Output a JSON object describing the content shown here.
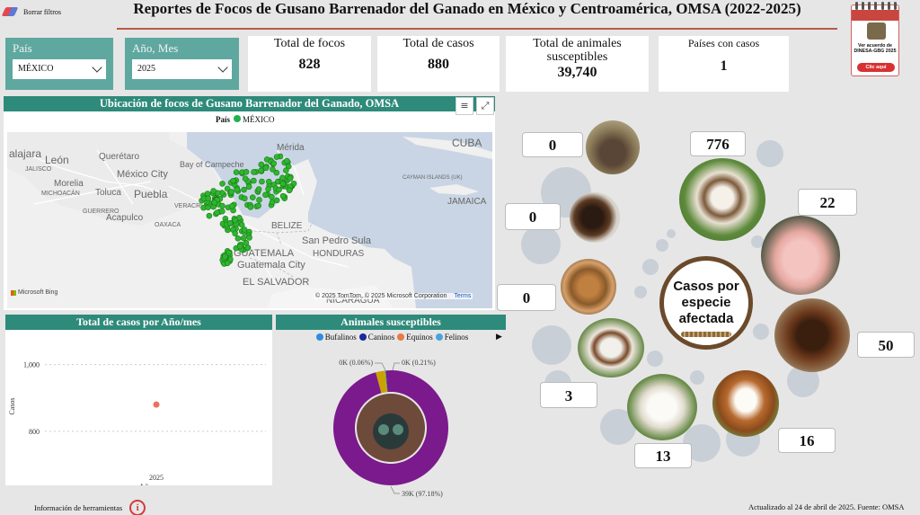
{
  "header": {
    "clear_filters_label": "Borrar filtros",
    "title": "Reportes de Focos de Gusano Barrenador del Ganado en México y Centroamérica, OMSA (2022-2025)"
  },
  "calendar_badge": {
    "text": "Ver acuerdo de DINESA-GBG 2025",
    "button_label": "Clic aquí"
  },
  "filters": {
    "country": {
      "label": "País",
      "value": "MÉXICO"
    },
    "year_month": {
      "label": "Año, Mes",
      "value": "2025"
    }
  },
  "kpis": [
    {
      "label": "Total de focos",
      "value": "828"
    },
    {
      "label": "Total de casos",
      "value": "880"
    },
    {
      "label": "Total de animales susceptibles",
      "value": "39,740"
    },
    {
      "label": "Países con casos",
      "value": "1"
    }
  ],
  "map": {
    "title": "Ubicación de focos de Gusano Barrenador del Ganado, OMSA",
    "legend_title": "País",
    "legend_item": "MÉXICO",
    "legend_color": "#22b14c",
    "labels": [
      "alajara",
      "León",
      "Querétaro",
      "JALISCO",
      "México City",
      "Morelia",
      "MICHOACÁN",
      "Toluca",
      "Puebla",
      "GUERRERO",
      "Acapulco",
      "OAXACA",
      "VERACRUZ",
      "Bay of Campeche",
      "Mérida",
      "BELIZE",
      "GUATEMALA",
      "Guatemala City",
      "San Pedro Sula",
      "HONDURAS",
      "EL SALVADOR",
      "NICARAGUA",
      "CUBA",
      "CAYMAN ISLANDS (UK)",
      "JAMAICA"
    ],
    "attribution": "© 2025 TomTom, © 2025 Microsoft Corporation",
    "terms_link": "Terms",
    "logo_text": "Microsoft Bing",
    "filter_icon": "filter-icon",
    "expand_icon": "focus-mode-icon"
  },
  "chart_data": [
    {
      "type": "scatter",
      "title": "Total de casos por Año/mes",
      "xlabel": "Año y mes",
      "ylabel": "Casos",
      "x": [
        "2025"
      ],
      "y": [
        880
      ],
      "yticks": [
        "1,000",
        "800"
      ],
      "ylim": [
        700,
        1050
      ],
      "grid": true,
      "marker_color": "#e8735a"
    },
    {
      "type": "pie",
      "subtype": "donut",
      "title": "Animales susceptibles",
      "legend": [
        "Bufalinos",
        "Caninos",
        "Equinos",
        "Felinos"
      ],
      "legend_colors": [
        "#2f8ce0",
        "#1b2a9b",
        "#e87a42",
        "#4aa3df"
      ],
      "slices": [
        {
          "label": "0K (0.06%)",
          "percent": 0.06,
          "color": "#e87a42"
        },
        {
          "label": "0K (0.21%)",
          "percent": 0.21,
          "color": "#2e9a5a"
        },
        {
          "label": "39K (97.18%)",
          "percent": 97.18,
          "color": "#7b1a8c"
        },
        {
          "label": "",
          "percent": 2.55,
          "color": "#c9a400"
        }
      ],
      "legend_position": "top"
    }
  ],
  "species": {
    "center_label": "Casos por especie afectada",
    "items": [
      {
        "name": "búfalo",
        "count": "0",
        "icon": "buffalo-icon"
      },
      {
        "name": "bovino",
        "count": "776",
        "icon": "cow-icon"
      },
      {
        "name": "ave",
        "count": "0",
        "icon": "hen-icon"
      },
      {
        "name": "porcino",
        "count": "22",
        "icon": "pig-icon"
      },
      {
        "name": "felino",
        "count": "0",
        "icon": "cat-icon"
      },
      {
        "name": "equino",
        "count": "50",
        "icon": "horse-icon"
      },
      {
        "name": "caprino",
        "count": "3",
        "icon": "goat-icon"
      },
      {
        "name": "ovino",
        "count": "13",
        "icon": "sheep-icon"
      },
      {
        "name": "canino",
        "count": "16",
        "icon": "dog-icon"
      }
    ]
  },
  "footer": {
    "tools_info": "Información de herramientas",
    "updated": "Actualizado al 24 de abril de 2025. Fuente: OMSA"
  }
}
